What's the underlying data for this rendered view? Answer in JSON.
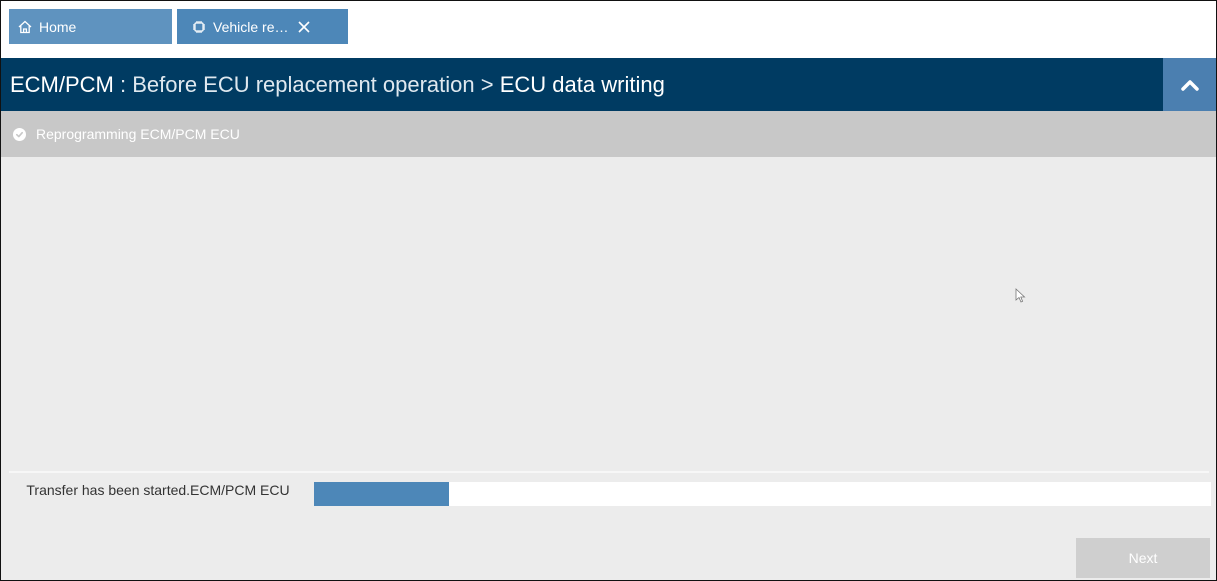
{
  "tabs": [
    {
      "label": "Home",
      "icon": "home-icon"
    },
    {
      "label": "Vehicle re…",
      "icon": "chip-icon"
    }
  ],
  "header": {
    "system": "ECM/PCM",
    "separator": " : ",
    "operation": "Before ECU replacement operation",
    "arrow": " > ",
    "step": "ECU data writing",
    "collapse_icon": "chevron-up-icon"
  },
  "stepbar": {
    "label": "Reprogramming ECM/PCM ECU",
    "icon": "check-circle-icon"
  },
  "progress": {
    "status": "Transfer has been started.ECM/PCM ECU",
    "fraction": 0.15
  },
  "actions": {
    "next_label": "Next"
  },
  "colors": {
    "header_bg": "#003b62",
    "accent": "#4d87b8",
    "home_tab": "#5f93bf",
    "stepbar_bg": "#c8c8c8",
    "content_bg": "#ececec"
  }
}
